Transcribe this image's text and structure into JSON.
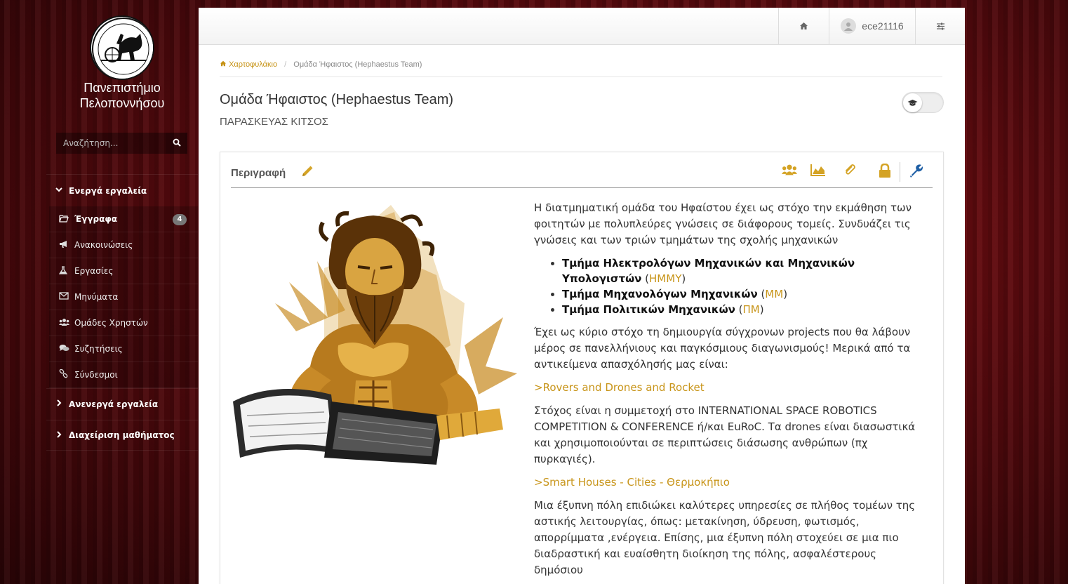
{
  "sidebar": {
    "university_line1": "Πανεπιστήμιο",
    "university_line2": "Πελοποννήσου",
    "search_placeholder": "Αναζήτηση...",
    "active_tools_label": "Ενεργά εργαλεία",
    "items": [
      {
        "label": "Έγγραφα",
        "icon": "folder-open-icon",
        "badge": "4"
      },
      {
        "label": "Ανακοινώσεις",
        "icon": "bullhorn-icon"
      },
      {
        "label": "Εργασίες",
        "icon": "flask-icon"
      },
      {
        "label": "Μηνύματα",
        "icon": "envelope-icon"
      },
      {
        "label": "Ομάδες Χρηστών",
        "icon": "users-icon"
      },
      {
        "label": "Συζητήσεις",
        "icon": "comments-icon"
      },
      {
        "label": "Σύνδεσμοι",
        "icon": "link-icon"
      }
    ],
    "inactive_tools_label": "Ανενεργά εργαλεία",
    "course_admin_label": "Διαχείριση μαθήματος"
  },
  "topbar": {
    "username": "ece21116"
  },
  "breadcrumb": {
    "home": "Χαρτοφυλάκιο",
    "separator": "/",
    "current": "Ομάδα Ήφαιστος (Hephaestus Team)"
  },
  "course": {
    "title": "Ομάδα Ήφαιστος (Hephaestus Team)",
    "instructor": "ΠΑΡΑΣΚΕΥΑΣ ΚΙΤΣΟΣ"
  },
  "panel": {
    "title": "Περιγραφή"
  },
  "description": {
    "intro": "Η διατμηματική ομάδα του Ηφαίστου έχει ως στόχο την εκμάθηση των φοιτητών με πολυπλεύρες γνώσεις σε διάφορους τομείς. Συνδυάζει τις γνώσεις και των τριών τμημάτων της σχολής μηχανικών",
    "departments": [
      {
        "name": "Τμήμα Ηλεκτρολόγων Μηχανικών και Μηχανικών Υπολογιστών",
        "abbr": "ΗΜΜΥ"
      },
      {
        "name": "Τμήμα Μηχανολόγων Μηχανικών",
        "abbr": "ΜΜ"
      },
      {
        "name": "Τμήμα Πολιτικών Μηχανικών",
        "abbr": "ΠΜ"
      }
    ],
    "goal": "Έχει ως κύριο στόχο τη δημιουργία σύγχρονων projects που θα λάβουν μέρος σε πανελλήνιους και παγκόσμιους διαγωνισμούς! Μερικά από τα αντικείμενα απασχόλησής μας είναι:",
    "topic1_title": ">Rovers and Drones and Rocket",
    "topic1_text": "Στόχος είναι η συμμετοχή στο INTERNATIONAL SPACE ROBOTICS COMPETITION & CONFERENCE ή/και EuRoC. Τα drones είναι διασωστικά και χρησιμοποιούνται σε περιπτώσεις διάσωσης ανθρώπων (πχ πυρκαγιές).",
    "topic2_title": ">Smart Houses - Cities - Θερμοκήπιο",
    "topic2_text": "Μια έξυπνη πόλη επιδιώκει καλύτερες υπηρεσίες σε πλήθος τομέων της αστικής λειτουργίας, όπως: μετακίνηση, ύδρευση, φωτισμός, απορρίμματα ,ενέργεια. Επίσης, μια έξυπνη πόλη στοχεύει σε μια πιο διαδραστική και ευαίσθητη διοίκηση της πόλης, ασφαλέστερους δημόσιου"
  },
  "colors": {
    "accent_gold": "#c8951a",
    "wrench_blue": "#1f5fa5",
    "background_red": "#6e0c11"
  }
}
